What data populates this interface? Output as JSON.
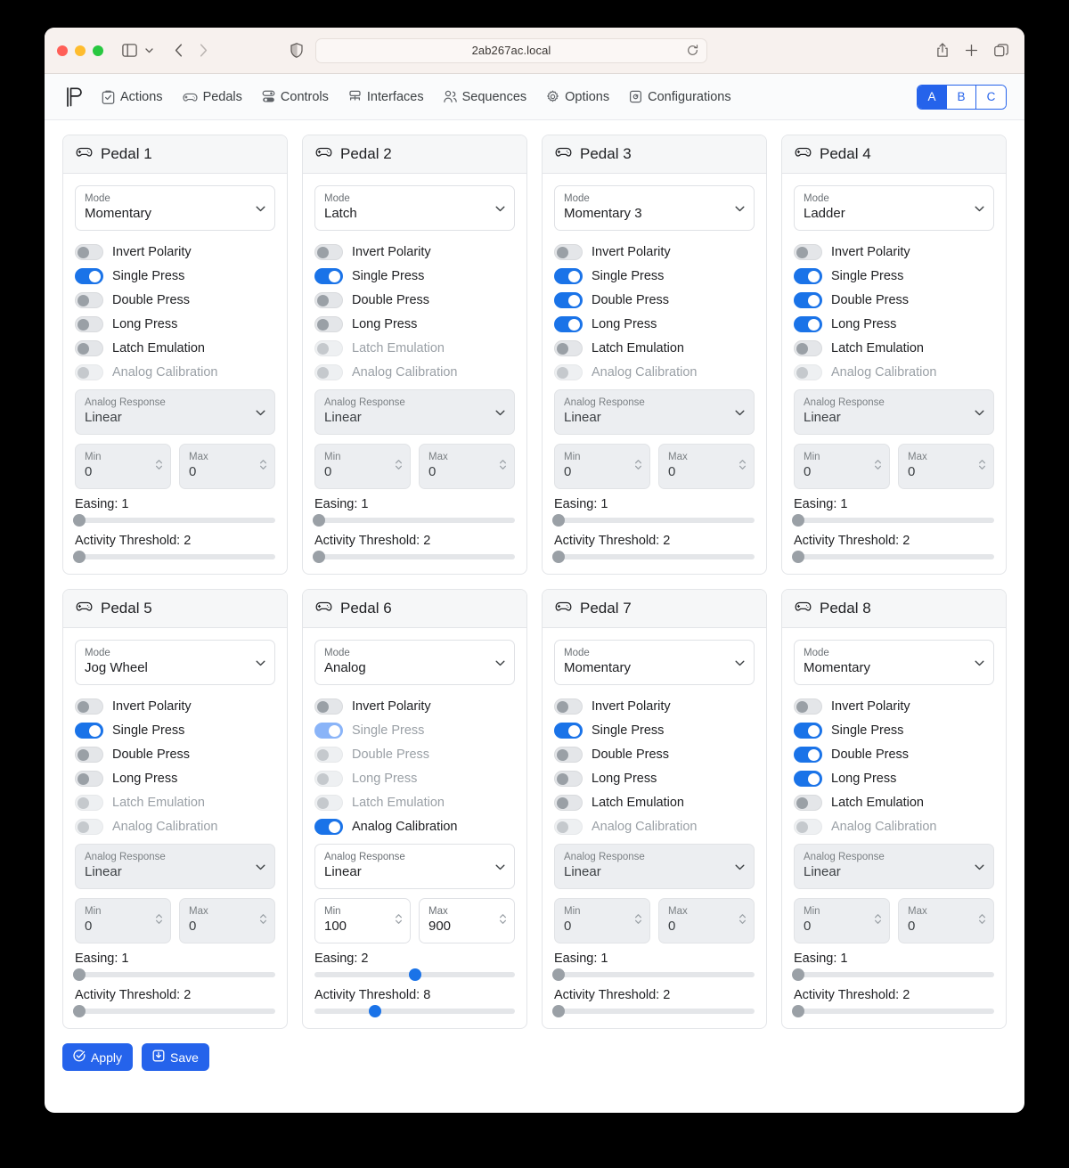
{
  "browser": {
    "url": "2ab267ac.local",
    "icons": {
      "sidebar": "sidebar-icon",
      "sidebar_chevron": "chevron-down-icon",
      "back": "back-chevron-icon",
      "forward": "forward-chevron-icon",
      "shield": "shield-icon",
      "reload": "reload-icon",
      "share": "share-icon",
      "new_tab": "plus-icon",
      "tabs": "tab-overview-icon"
    }
  },
  "appnav": {
    "logo": "pedal-logo",
    "items": [
      {
        "label": "Actions",
        "icon": "clipboard-check-icon"
      },
      {
        "label": "Pedals",
        "icon": "gamepad-icon"
      },
      {
        "label": "Controls",
        "icon": "sliders-icon"
      },
      {
        "label": "Interfaces",
        "icon": "network-icon"
      },
      {
        "label": "Sequences",
        "icon": "users-icon"
      },
      {
        "label": "Options",
        "icon": "gear-icon"
      },
      {
        "label": "Configurations",
        "icon": "config-icon"
      }
    ],
    "segments": [
      {
        "label": "A",
        "active": true
      },
      {
        "label": "B",
        "active": false
      },
      {
        "label": "C",
        "active": false
      }
    ],
    "accent_color": "#2563eb"
  },
  "labels": {
    "mode": "Mode",
    "analog_response": "Analog Response",
    "min": "Min",
    "max": "Max",
    "easing": "Easing:",
    "activity_threshold": "Activity Threshold:",
    "invert_polarity": "Invert Polarity",
    "single_press": "Single Press",
    "double_press": "Double Press",
    "long_press": "Long Press",
    "latch_emulation": "Latch Emulation",
    "analog_calibration": "Analog Calibration"
  },
  "pedals": [
    {
      "title": "Pedal 1",
      "icon": "gamepad-icon",
      "mode": "Momentary",
      "toggles": {
        "invert_polarity": {
          "on": false,
          "enabled": true
        },
        "single_press": {
          "on": true,
          "enabled": true
        },
        "double_press": {
          "on": false,
          "enabled": true
        },
        "long_press": {
          "on": false,
          "enabled": true
        },
        "latch_emulation": {
          "on": false,
          "enabled": true
        },
        "analog_calibration": {
          "on": false,
          "enabled": false
        }
      },
      "analog_response": "Linear",
      "analog_enabled": false,
      "min": "0",
      "max": "0",
      "easing": "1",
      "easing_pct": 2,
      "activity_threshold": "2",
      "activity_pct": 2,
      "sliders_enabled": false
    },
    {
      "title": "Pedal 2",
      "icon": "gamepad-icon",
      "mode": "Latch",
      "toggles": {
        "invert_polarity": {
          "on": false,
          "enabled": true
        },
        "single_press": {
          "on": true,
          "enabled": true
        },
        "double_press": {
          "on": false,
          "enabled": true
        },
        "long_press": {
          "on": false,
          "enabled": true
        },
        "latch_emulation": {
          "on": false,
          "enabled": false
        },
        "analog_calibration": {
          "on": false,
          "enabled": false
        }
      },
      "analog_response": "Linear",
      "analog_enabled": false,
      "min": "0",
      "max": "0",
      "easing": "1",
      "easing_pct": 2,
      "activity_threshold": "2",
      "activity_pct": 2,
      "sliders_enabled": false
    },
    {
      "title": "Pedal 3",
      "icon": "gamepad-icon",
      "mode": "Momentary 3",
      "toggles": {
        "invert_polarity": {
          "on": false,
          "enabled": true
        },
        "single_press": {
          "on": true,
          "enabled": true
        },
        "double_press": {
          "on": true,
          "enabled": true
        },
        "long_press": {
          "on": true,
          "enabled": true
        },
        "latch_emulation": {
          "on": false,
          "enabled": true
        },
        "analog_calibration": {
          "on": false,
          "enabled": false
        }
      },
      "analog_response": "Linear",
      "analog_enabled": false,
      "min": "0",
      "max": "0",
      "easing": "1",
      "easing_pct": 2,
      "activity_threshold": "2",
      "activity_pct": 2,
      "sliders_enabled": false
    },
    {
      "title": "Pedal 4",
      "icon": "gamepad-icon",
      "mode": "Ladder",
      "toggles": {
        "invert_polarity": {
          "on": false,
          "enabled": true
        },
        "single_press": {
          "on": true,
          "enabled": true
        },
        "double_press": {
          "on": true,
          "enabled": true
        },
        "long_press": {
          "on": true,
          "enabled": true
        },
        "latch_emulation": {
          "on": false,
          "enabled": true
        },
        "analog_calibration": {
          "on": false,
          "enabled": false
        }
      },
      "analog_response": "Linear",
      "analog_enabled": false,
      "min": "0",
      "max": "0",
      "easing": "1",
      "easing_pct": 2,
      "activity_threshold": "2",
      "activity_pct": 2,
      "sliders_enabled": false
    },
    {
      "title": "Pedal 5",
      "icon": "gamepad-icon",
      "mode": "Jog Wheel",
      "toggles": {
        "invert_polarity": {
          "on": false,
          "enabled": true
        },
        "single_press": {
          "on": true,
          "enabled": true
        },
        "double_press": {
          "on": false,
          "enabled": true
        },
        "long_press": {
          "on": false,
          "enabled": true
        },
        "latch_emulation": {
          "on": false,
          "enabled": false
        },
        "analog_calibration": {
          "on": false,
          "enabled": false
        }
      },
      "analog_response": "Linear",
      "analog_enabled": false,
      "min": "0",
      "max": "0",
      "easing": "1",
      "easing_pct": 2,
      "activity_threshold": "2",
      "activity_pct": 2,
      "sliders_enabled": false
    },
    {
      "title": "Pedal 6",
      "icon": "gamepad-icon",
      "mode": "Analog",
      "toggles": {
        "invert_polarity": {
          "on": false,
          "enabled": true
        },
        "single_press": {
          "on": true,
          "enabled": false
        },
        "double_press": {
          "on": false,
          "enabled": false
        },
        "long_press": {
          "on": false,
          "enabled": false
        },
        "latch_emulation": {
          "on": false,
          "enabled": false
        },
        "analog_calibration": {
          "on": true,
          "enabled": true
        }
      },
      "analog_response": "Linear",
      "analog_enabled": true,
      "min": "100",
      "max": "900",
      "easing": "2",
      "easing_pct": 50,
      "activity_threshold": "8",
      "activity_pct": 30,
      "sliders_enabled": true
    },
    {
      "title": "Pedal 7",
      "icon": "gamepad-icon",
      "mode": "Momentary",
      "toggles": {
        "invert_polarity": {
          "on": false,
          "enabled": true
        },
        "single_press": {
          "on": true,
          "enabled": true
        },
        "double_press": {
          "on": false,
          "enabled": true
        },
        "long_press": {
          "on": false,
          "enabled": true
        },
        "latch_emulation": {
          "on": false,
          "enabled": true
        },
        "analog_calibration": {
          "on": false,
          "enabled": false
        }
      },
      "analog_response": "Linear",
      "analog_enabled": false,
      "min": "0",
      "max": "0",
      "easing": "1",
      "easing_pct": 2,
      "activity_threshold": "2",
      "activity_pct": 2,
      "sliders_enabled": false
    },
    {
      "title": "Pedal 8",
      "icon": "gamepad-icon",
      "mode": "Momentary",
      "toggles": {
        "invert_polarity": {
          "on": false,
          "enabled": true
        },
        "single_press": {
          "on": true,
          "enabled": true
        },
        "double_press": {
          "on": true,
          "enabled": true
        },
        "long_press": {
          "on": true,
          "enabled": true
        },
        "latch_emulation": {
          "on": false,
          "enabled": true
        },
        "analog_calibration": {
          "on": false,
          "enabled": false
        }
      },
      "analog_response": "Linear",
      "analog_enabled": false,
      "min": "0",
      "max": "0",
      "easing": "1",
      "easing_pct": 2,
      "activity_threshold": "2",
      "activity_pct": 2,
      "sliders_enabled": false
    }
  ],
  "footer": {
    "apply_label": "Apply",
    "apply_icon": "circle-check-icon",
    "save_label": "Save",
    "save_icon": "save-icon"
  }
}
